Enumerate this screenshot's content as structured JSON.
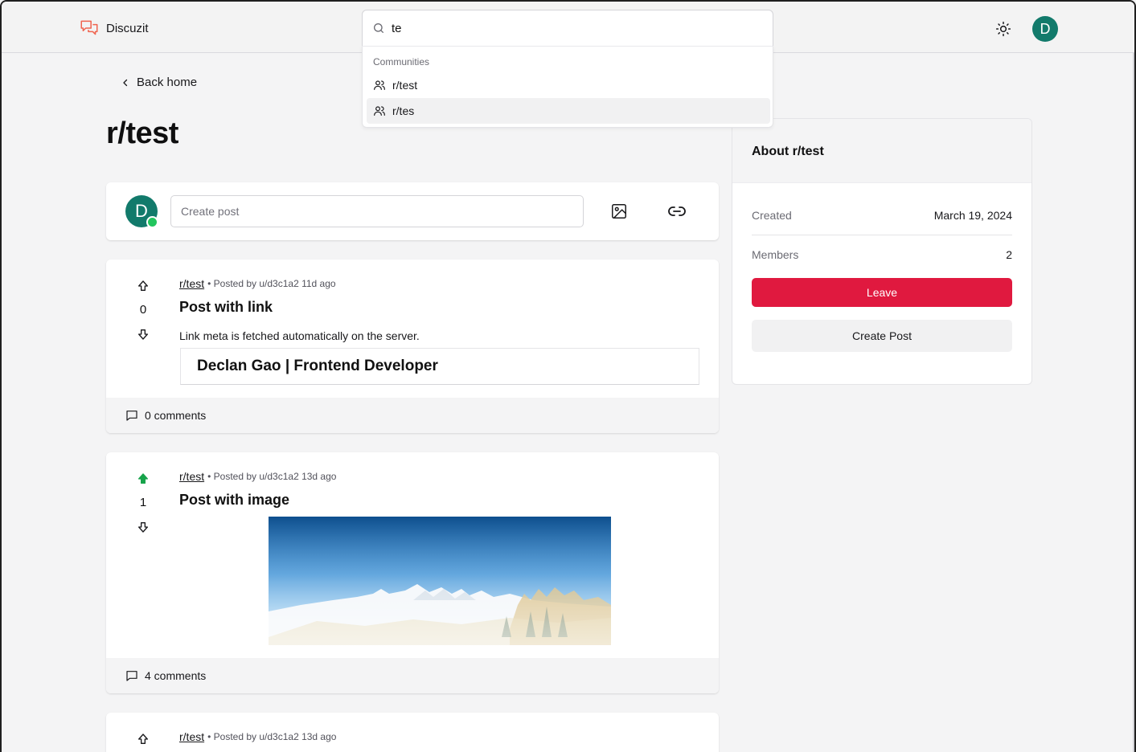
{
  "app": {
    "name": "Discuzit",
    "user_initial": "D"
  },
  "search": {
    "value": "te",
    "section_heading": "Communities",
    "results": [
      {
        "label": "r/test"
      },
      {
        "label": "r/tes"
      }
    ]
  },
  "nav": {
    "back_label": "Back home"
  },
  "page": {
    "title": "r/test"
  },
  "composer": {
    "placeholder": "Create post",
    "avatar_initial": "D"
  },
  "posts": [
    {
      "subreddit": "r/test",
      "meta": "• Posted by u/d3c1a2 11d ago",
      "title": "Post with link",
      "votes": "0",
      "upvoted": false,
      "body": "Link meta is fetched automatically on the server.",
      "link_title": "Declan Gao | Frontend Developer",
      "comments": "0 comments"
    },
    {
      "subreddit": "r/test",
      "meta": "• Posted by u/d3c1a2 13d ago",
      "title": "Post with image",
      "votes": "1",
      "upvoted": true,
      "comments": "4 comments"
    },
    {
      "subreddit": "r/test",
      "meta": "• Posted by u/d3c1a2 13d ago"
    }
  ],
  "about": {
    "title": "About r/test",
    "created_label": "Created",
    "created_value": "March 19, 2024",
    "members_label": "Members",
    "members_value": "2",
    "leave_label": "Leave",
    "create_post_label": "Create Post"
  },
  "colors": {
    "brand": "#f0644f",
    "avatar": "#127a6b",
    "online": "#22c55e",
    "leave": "#e0193f",
    "upvote_active": "#16a34a"
  }
}
